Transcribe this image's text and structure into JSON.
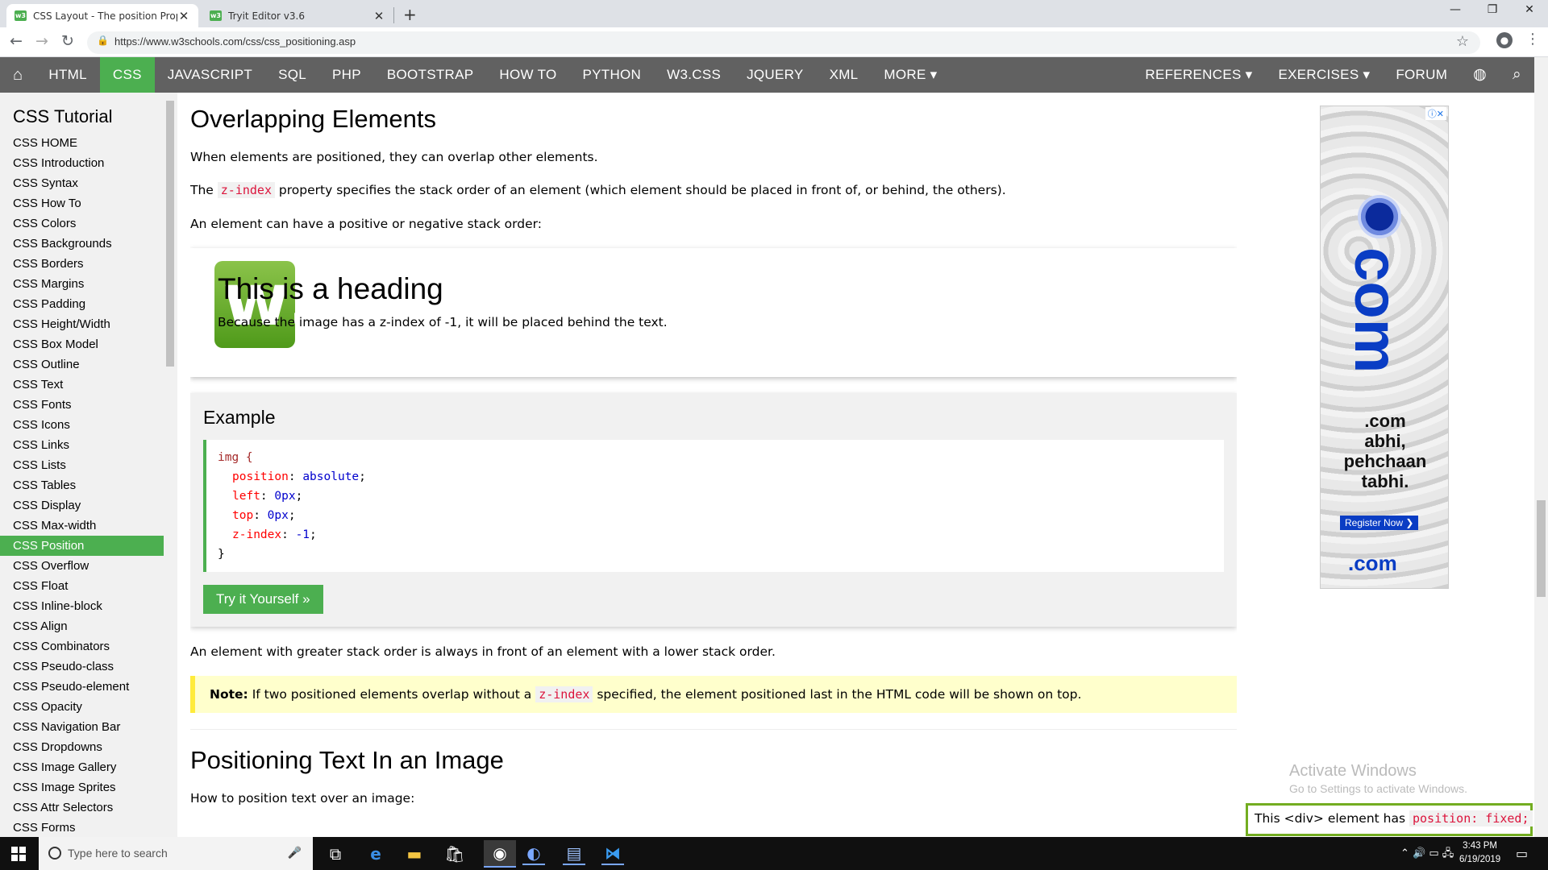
{
  "browser": {
    "tabs": [
      {
        "title": "CSS Layout - The position Prope",
        "active": true
      },
      {
        "title": "Tryit Editor v3.6",
        "active": false
      }
    ],
    "new_tab": "+",
    "close": "✕",
    "url": "https://www.w3schools.com/css/css_positioning.asp",
    "window_controls": {
      "minimize": "—",
      "maximize": "❐",
      "close": "✕"
    }
  },
  "topnav": {
    "left": [
      "HTML",
      "CSS",
      "JAVASCRIPT",
      "SQL",
      "PHP",
      "BOOTSTRAP",
      "HOW TO",
      "PYTHON",
      "W3.CSS",
      "JQUERY",
      "XML",
      "MORE ▾"
    ],
    "active_index": 1,
    "right": [
      "REFERENCES ▾",
      "EXERCISES ▾",
      "FORUM"
    ],
    "icons": [
      "home-icon",
      "globe-icon",
      "search-icon"
    ]
  },
  "sidebar": {
    "heading": "CSS Tutorial",
    "items": [
      "CSS HOME",
      "CSS Introduction",
      "CSS Syntax",
      "CSS How To",
      "CSS Colors",
      "CSS Backgrounds",
      "CSS Borders",
      "CSS Margins",
      "CSS Padding",
      "CSS Height/Width",
      "CSS Box Model",
      "CSS Outline",
      "CSS Text",
      "CSS Fonts",
      "CSS Icons",
      "CSS Links",
      "CSS Lists",
      "CSS Tables",
      "CSS Display",
      "CSS Max-width",
      "CSS Position",
      "CSS Overflow",
      "CSS Float",
      "CSS Inline-block",
      "CSS Align",
      "CSS Combinators",
      "CSS Pseudo-class",
      "CSS Pseudo-element",
      "CSS Opacity",
      "CSS Navigation Bar",
      "CSS Dropdowns",
      "CSS Image Gallery",
      "CSS Image Sprites",
      "CSS Attr Selectors",
      "CSS Forms"
    ],
    "active_index": 20
  },
  "main": {
    "heading": "Overlapping Elements",
    "p1": "When elements are positioned, they can overlap other elements.",
    "p2_pre": "The",
    "p2_code": "z-index",
    "p2_post": "property specifies the stack order of an element (which element should be placed in front of, or behind, the others).",
    "p3": "An element can have a positive or negative stack order:",
    "demo": {
      "logo_text": "w3",
      "heading": "This is a heading",
      "text": "Because the image has a z-index of -1, it will be placed behind the text."
    },
    "example": {
      "title": "Example",
      "code": {
        "selector": "img {",
        "lines": [
          {
            "prop": "position",
            "val": "absolute"
          },
          {
            "prop": "left",
            "val": "0px"
          },
          {
            "prop": "top",
            "val": "0px"
          },
          {
            "prop": "z-index",
            "val": "-1"
          }
        ],
        "close": "}"
      },
      "button": "Try it Yourself »"
    },
    "p4": "An element with greater stack order is always in front of an element with a lower stack order.",
    "note": {
      "label": "Note:",
      "pre": "If two positioned elements overlap without a",
      "code": "z-index",
      "post": "specified, the element positioned last in the HTML code will be shown on top."
    },
    "heading2": "Positioning Text In an Image",
    "p5": "How to position text over an image:"
  },
  "ad": {
    "big": "com",
    "copy": [
      ".com",
      "abhi,",
      "pehchaan",
      "tabhi."
    ],
    "register": "Register Now ❯",
    "foot": ".com"
  },
  "activate": {
    "title": "Activate Windows",
    "subtitle": "Go to Settings to activate Windows."
  },
  "fixed_box": {
    "pre": "This <div> element has",
    "code": "position: fixed;"
  },
  "taskbar": {
    "search_placeholder": "Type here to search",
    "time": "3:43 PM",
    "date": "6/19/2019"
  },
  "colors": {
    "accent": "#4caf50",
    "nav": "#616161",
    "note_bg": "#ffffcc",
    "note_border": "#ffeb3b",
    "fixed_border": "#73ad21"
  }
}
